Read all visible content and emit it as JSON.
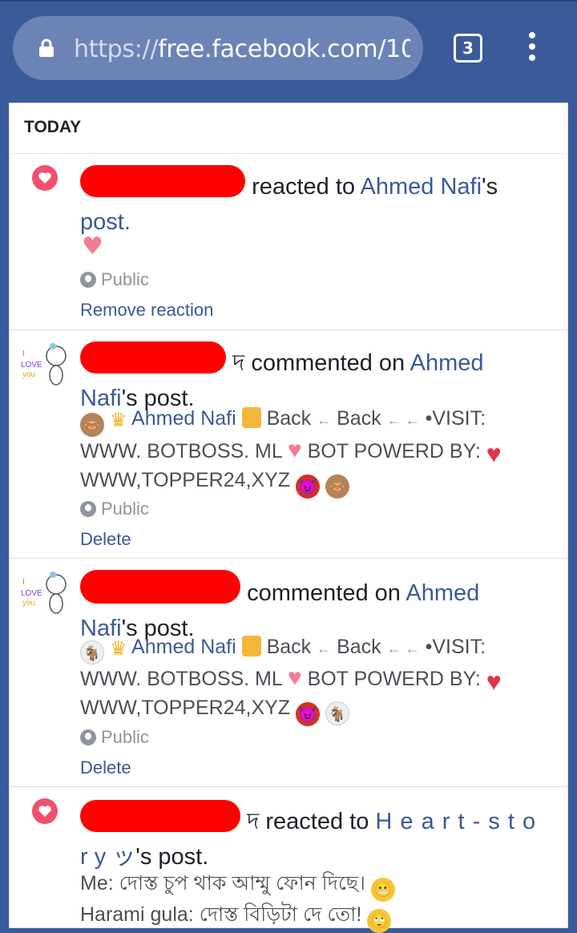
{
  "browser": {
    "url_scheme": "https://",
    "url_host": "free.facebook.com/10",
    "tab_count": "3"
  },
  "section_title": "TODAY",
  "notifications": [
    {
      "name_tail": "reacted to",
      "target_name": "Ahmed Nafi",
      "target_suffix": "'s",
      "post_word": "post.",
      "privacy": "Public",
      "action": "Remove reaction"
    },
    {
      "name_tail": "দ commented on",
      "target_name": "Ahmed",
      "target_name2": "Nafi",
      "target_suffix": "'s post.",
      "comment_author": "Ahmed Nafi",
      "comment_back1": "Back",
      "comment_back2": "Back",
      "comment_visit": "•VISIT:",
      "comment_line2a": "WWW. BOTBOSS. ML",
      "comment_line2b": "BOT POWERD BY:",
      "comment_line3": "WWW,TOPPER24,XYZ",
      "privacy": "Public",
      "action": "Delete"
    },
    {
      "name_tail": "commented on",
      "target_name": "Ahmed",
      "target_name2": "Nafi",
      "target_suffix": "'s post.",
      "comment_author": "Ahmed Nafi",
      "comment_back1": "Back",
      "comment_back2": "Back",
      "comment_visit": "•VISIT:",
      "comment_line2a": "WWW. BOTBOSS. ML",
      "comment_line2b": "BOT POWERD BY:",
      "comment_line3": "WWW,TOPPER24,XYZ",
      "privacy": "Public",
      "action": "Delete"
    },
    {
      "name_tail": "দ reacted to",
      "target_name": "H e a r t - s  t  o",
      "target_name2": "r  y ッ",
      "target_suffix": "'s post.",
      "line1": "Me: দোস্ত চুপ থাক আম্মু ফোন দিছে।",
      "line2": "Harami gula: দোস্ত বিড়িটা দে তো!"
    }
  ]
}
